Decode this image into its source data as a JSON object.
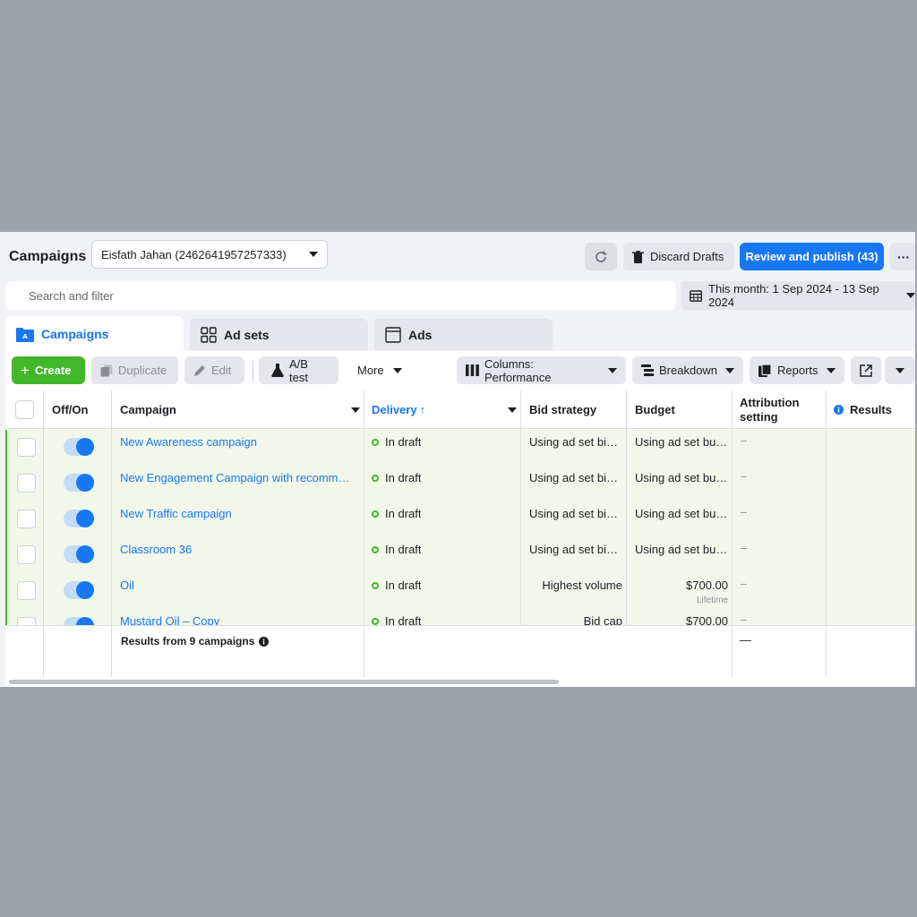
{
  "header": {
    "title": "Campaigns",
    "account": "Eisfath Jahan (2462641957257333)",
    "discard_label": "Discard Drafts",
    "publish_label": "Review and publish (43)",
    "more_label": "···"
  },
  "search": {
    "placeholder": "Search and filter"
  },
  "date_range": {
    "label": "This month: 1 Sep 2024 - 13 Sep 2024"
  },
  "tabs": [
    {
      "label": "Campaigns",
      "active": true
    },
    {
      "label": "Ad sets",
      "active": false
    },
    {
      "label": "Ads",
      "active": false
    }
  ],
  "toolbar": {
    "create": "Create",
    "duplicate": "Duplicate",
    "edit": "Edit",
    "ab_test": "A/B test",
    "more": "More",
    "columns": "Columns: Performance",
    "breakdown": "Breakdown",
    "reports": "Reports"
  },
  "table": {
    "columns": {
      "off_on": "Off/On",
      "campaign": "Campaign",
      "delivery": "Delivery",
      "bid_strategy": "Bid strategy",
      "budget": "Budget",
      "attribution_1": "Attribution",
      "attribution_2": "setting",
      "results": "Results"
    },
    "rows": [
      {
        "name": "New Awareness campaign",
        "delivery": "In draft",
        "bid": "Using ad set bid ...",
        "budget": "Using ad set bud...",
        "sub": "",
        "attr": "–"
      },
      {
        "name": "New Engagement Campaign with recommend...",
        "delivery": "In draft",
        "bid": "Using ad set bid ...",
        "budget": "Using ad set bud...",
        "sub": "",
        "attr": "–"
      },
      {
        "name": "New Traffic campaign",
        "delivery": "In draft",
        "bid": "Using ad set bid ...",
        "budget": "Using ad set bud...",
        "sub": "",
        "attr": "–"
      },
      {
        "name": "Classroom 36",
        "delivery": "In draft",
        "bid": "Using ad set bid ...",
        "budget": "Using ad set bud...",
        "sub": "",
        "attr": "–"
      },
      {
        "name": "Oil",
        "delivery": "In draft",
        "bid": "Highest volume",
        "budget": "$700.00",
        "sub": "Lifetime",
        "attr": "–"
      },
      {
        "name": "Mustard Oil – Copy",
        "delivery": "In draft",
        "bid": "Bid cap",
        "budget": "$700.00",
        "sub": "",
        "attr": "–"
      }
    ],
    "footer": {
      "results_label": "Results from 9 campaigns",
      "attribution": "—"
    }
  },
  "colors": {
    "primary": "#1877f2",
    "create": "#42b72a",
    "row_highlight": "#f1f8ea"
  }
}
